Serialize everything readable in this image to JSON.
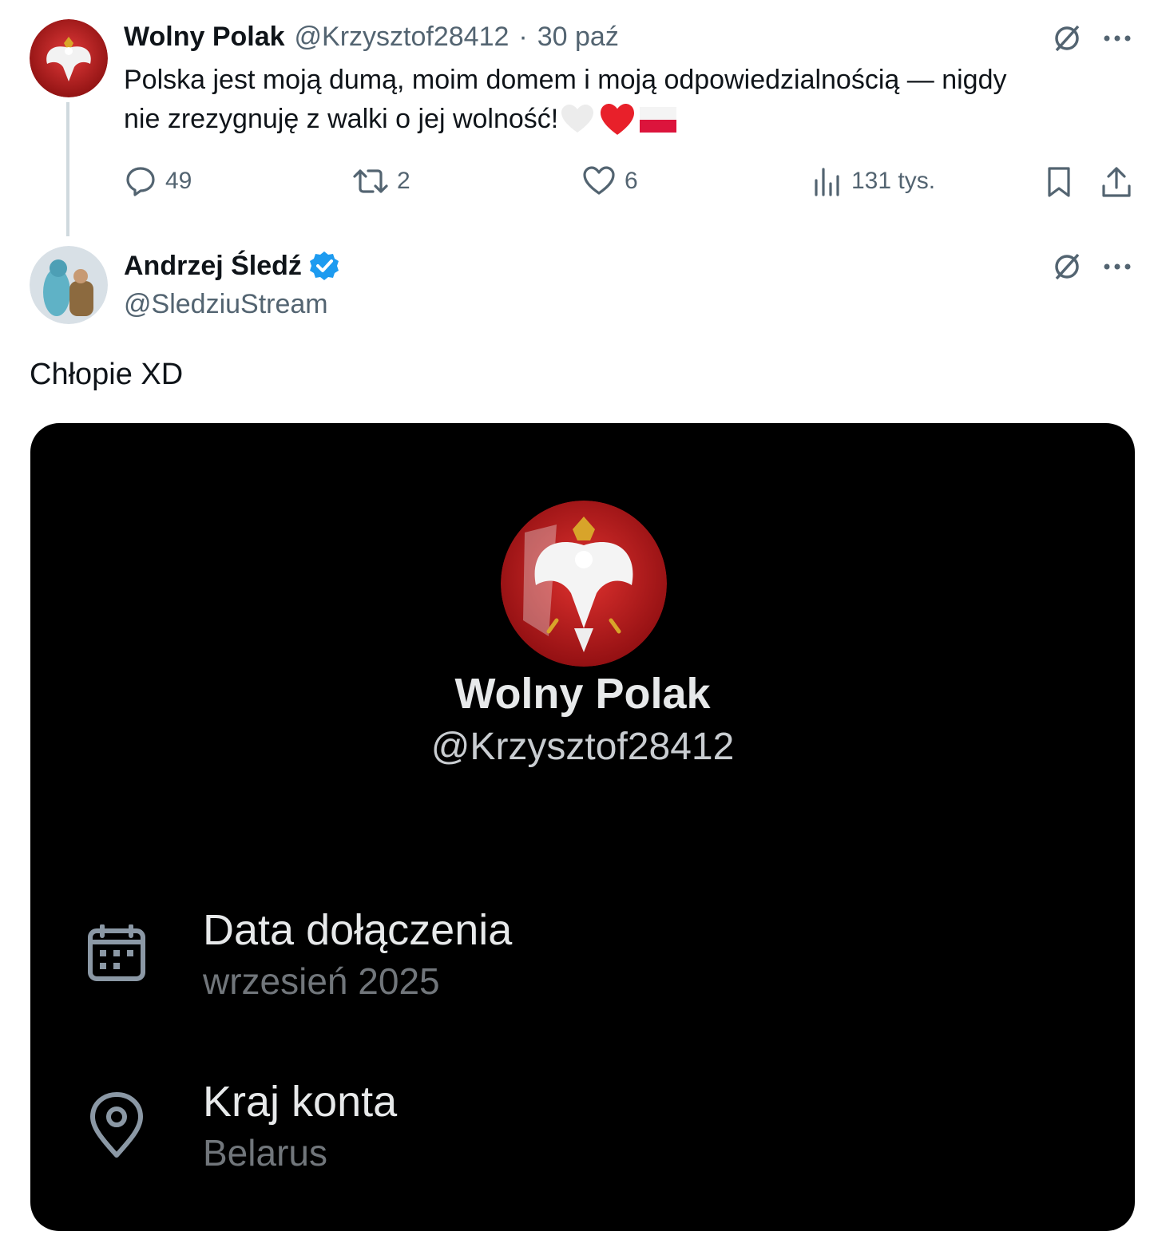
{
  "original_tweet": {
    "author_name": "Wolny Polak",
    "handle": "@Krzysztof28412",
    "separator": "·",
    "date": "30 paź",
    "text_line1": "Polska jest moją dumą, moim domem i moją odpowiedzialnością — nigdy",
    "text_line2": "nie zrezygnuję z walki o jej wolność!",
    "emojis": [
      "white-heart",
      "red-heart",
      "poland-flag"
    ],
    "actions": {
      "replies": "49",
      "reposts": "2",
      "likes": "6",
      "views": "131 tys."
    }
  },
  "reply_tweet": {
    "author_name": "Andrzej Śledź",
    "verified": true,
    "handle": "@SledziuStream",
    "text": "Chłopie XD"
  },
  "embedded_card": {
    "name": "Wolny Polak",
    "handle": "@Krzysztof28412",
    "rows": [
      {
        "icon": "calendar-icon",
        "title": "Data dołączenia",
        "value": "wrzesień 2025"
      },
      {
        "icon": "location-pin-icon",
        "title": "Kraj konta",
        "value": "Belarus"
      }
    ]
  },
  "colors": {
    "text_primary": "#0f1419",
    "text_secondary": "#536471",
    "verified_blue": "#1d9bf0",
    "heart_red": "#f91880",
    "card_bg": "#000000"
  }
}
